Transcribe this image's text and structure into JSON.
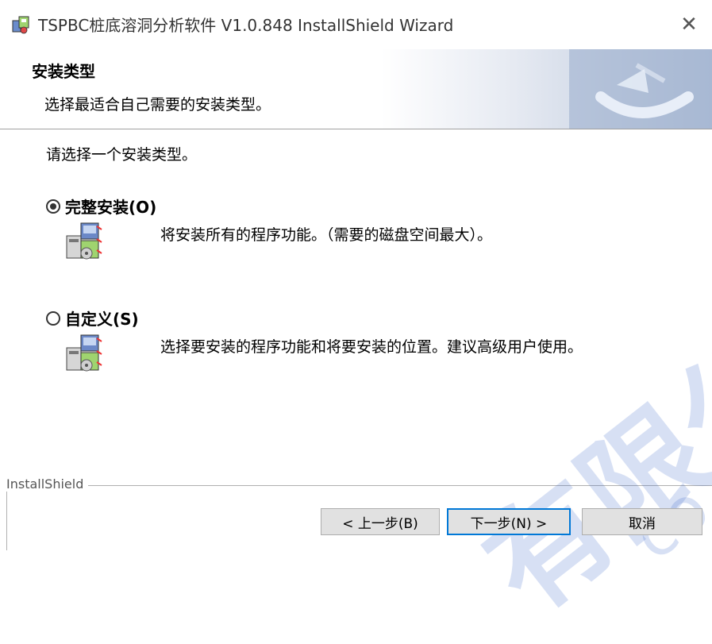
{
  "window": {
    "title": "TSPBC桩底溶洞分析软件 V1.0.848 InstallShield Wizard",
    "close_glyph": "✕"
  },
  "banner": {
    "heading": "安装类型",
    "subtitle": "选择最适合自己需要的安装类型。"
  },
  "main": {
    "prompt": "请选择一个安装类型。",
    "options": [
      {
        "label": "完整安装(O)",
        "description": "将安装所有的程序功能。（需要的磁盘空间最大）。",
        "selected": true,
        "icon": "feature-install-icon"
      },
      {
        "label": "自定义(S)",
        "description": "选择要安装的程序功能和将要安装的位置。建议高级用户使用。",
        "selected": false,
        "icon": "feature-install-icon"
      }
    ]
  },
  "footer": {
    "frame_label": "InstallShield",
    "back_button": "< 上一步(B)",
    "next_button": "下一步(N) >",
    "cancel_button": "取消"
  },
  "watermark": {
    "text": "有限公",
    "text2": "co"
  },
  "colors": {
    "accent": "#0078d7",
    "banner_gradient_end": "#b6c4da",
    "watermark": "#2a5ac8"
  }
}
